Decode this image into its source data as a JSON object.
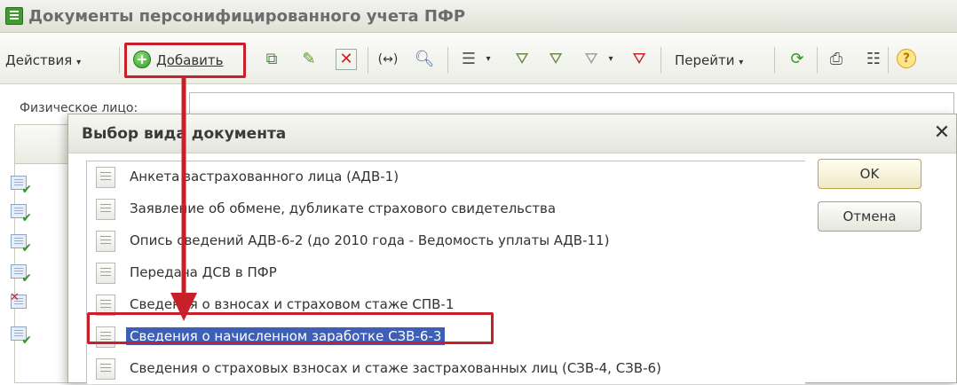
{
  "window": {
    "title": "Документы персонифицированного учета ПФР"
  },
  "toolbar": {
    "actions_label": "Действия",
    "add_label": "Добавить",
    "goto_label": "Перейти"
  },
  "form": {
    "physical_person_label": "Физическое лицо:"
  },
  "dialog": {
    "title": "Выбор вида документа",
    "items": [
      "Анкета застрахованного лица (АДВ-1)",
      "Заявление об обмене, дубликате страхового свидетельства",
      "Опись сведений АДВ-6-2 (до 2010 года - Ведомость уплаты АДВ-11)",
      "Передача ДСВ в ПФР",
      "Сведения о взносах и страховом стаже СПВ-1",
      "Сведения о начисленном заработке СЗВ-6-3",
      "Сведения о страховых взносах и стаже застрахованных лиц (СЗВ-4, СЗВ-6)"
    ],
    "selected_index": 5,
    "ok_label": "OK",
    "cancel_label": "Отмена"
  },
  "colors": {
    "highlight_red": "#c8202a",
    "selection_blue": "#3d5fb8"
  }
}
